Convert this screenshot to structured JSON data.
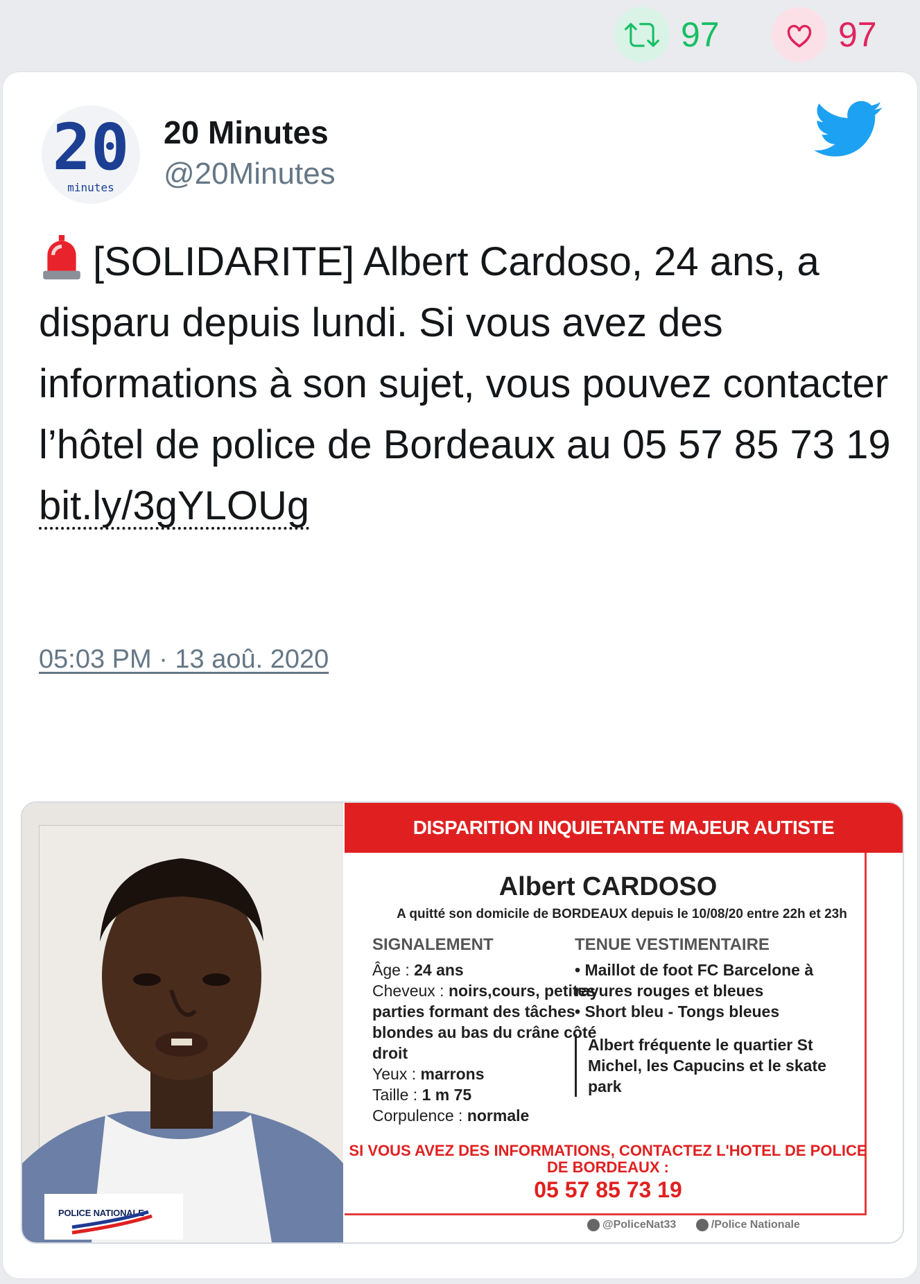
{
  "stats": {
    "retweets": "97",
    "likes": "97"
  },
  "colors": {
    "retweet": "#17bf63",
    "like": "#e0245e",
    "twitter_blue": "#1da1f2"
  },
  "author": {
    "name": "20 Minutes",
    "handle": "@20Minutes",
    "avatar_text": "20",
    "avatar_sub": "minutes"
  },
  "tweet": {
    "text": "[SOLIDARITE] Albert Cardoso, 24 ans, a disparu depuis lundi. Si vous avez des informations à son sujet, vous pouvez contacter l’hôtel de police de Bordeaux au 05 57 85 73 19",
    "link": "bit.ly/3gYLOUg",
    "timestamp": "05:03 PM · 13 aoû. 2020"
  },
  "poster": {
    "banner": "DISPARITION INQUIETANTE  MAJEUR AUTISTE",
    "name": "Albert CARDOSO",
    "left_home": "A quitté son domicile de BORDEAUX depuis le 10/08/20 entre 22h et 23h",
    "signalement": {
      "heading": "SIGNALEMENT",
      "age_label": "Âge :",
      "age": "24 ans",
      "hair_label": "Cheveux :",
      "hair": "noirs,cours, petites parties formant des tâches blondes au bas du crâne côté droit",
      "eyes_label": "Yeux :",
      "eyes": "marrons",
      "height_label": "Taille :",
      "height": "1 m 75",
      "build_label": "Corpulence :",
      "build": "normale"
    },
    "tenue": {
      "heading": "TENUE VESTIMENTAIRE",
      "item1": "• Maillot de foot FC Barcelone à rayures rouges et bleues",
      "item2": "• Short bleu - Tongs bleues",
      "note": "Albert fréquente le quartier St Michel, les Capucins et le skate park"
    },
    "contact": "SI VOUS AVEZ DES INFORMATIONS, CONTACTEZ L'HOTEL DE POLICE DE BORDEAUX :",
    "phone": "05 57 85 73 19",
    "twitter": "@PoliceNat33",
    "facebook": "/Police Nationale",
    "logo_text": "POLICE NATIONALE"
  }
}
